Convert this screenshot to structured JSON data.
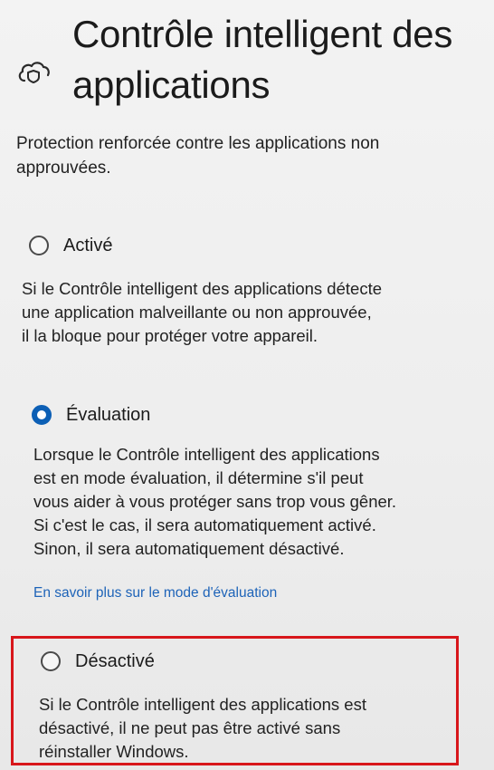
{
  "header": {
    "icon": "cloud-shield-icon",
    "title_line1": "Contrôle intelligent des",
    "title_line2": "applications"
  },
  "subtitle": {
    "line1": "Protection renforcée contre les applications non",
    "line2": "approuvées."
  },
  "options": [
    {
      "label": "Activé",
      "checked": false,
      "description": [
        "Si le Contrôle intelligent des applications détecte",
        "une application malveillante ou non approuvée,",
        "il la bloque pour protéger votre appareil."
      ]
    },
    {
      "label": "Évaluation",
      "checked": true,
      "description": [
        "Lorsque le Contrôle intelligent des applications",
        "est en mode évaluation, il détermine s'il peut",
        "vous aider à vous protéger sans trop vous gêner.",
        "Si c'est le cas, il sera automatiquement activé.",
        "Sinon, il sera automatiquement désactivé."
      ],
      "link": "En savoir plus sur le mode d'évaluation"
    },
    {
      "label": "Désactivé",
      "checked": false,
      "description": [
        "Si le Contrôle intelligent des applications est",
        "désactivé, il ne peut pas être activé sans",
        "réinstaller Windows."
      ]
    }
  ],
  "colors": {
    "accent": "#0c5fb5",
    "link": "#1d63b8",
    "highlight": "#d8161b",
    "background": "#efefef"
  }
}
